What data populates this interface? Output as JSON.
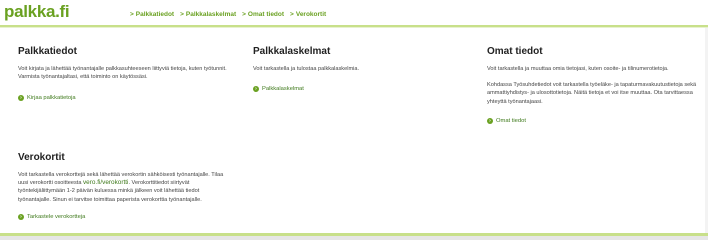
{
  "logo": {
    "text": "palkka.fi"
  },
  "nav": [
    {
      "label": "Palkkatiedot"
    },
    {
      "label": "Palkkalaskelmat"
    },
    {
      "label": "Omat tiedot"
    },
    {
      "label": "Verokortit"
    }
  ],
  "nav_arrow": ">",
  "colors": {
    "accent": "#6aa121",
    "link": "#3f7a1c",
    "stripe": "#c8e08a"
  },
  "cards": {
    "palkkatiedot": {
      "title": "Palkkatiedot",
      "text1": "Voit kirjata ja lähettää työnantajalle palkkasuhteeseen liittyviä tietoja, kuten työtunnit.",
      "text2": "Varmista työnantajaltasi, että toiminto on käytössäsi.",
      "link": "Kirjaa palkkatietoja"
    },
    "palkkalaskelmat": {
      "title": "Palkkalaskelmat",
      "text1": "Voit tarkastella ja tulostaa palkkalaskelmia.",
      "link": "Palkkalaskelmat"
    },
    "omat": {
      "title": "Omat tiedot",
      "text1": "Voit tarkastella ja muuttaa omia tietojasi, kuten osoite- ja tilinumerotietoja.",
      "text2": "Kohdassa Työsuhdetiedot voit tarkastella työeläke- ja tapaturmavakuutustietoja sekä ammattiyhdistys- ja ulosottotietoja. Näitä tietoja et voi itse muuttaa. Ota tarvittaessa yhteyttä työnantajaasi.",
      "link": "Omat tiedot"
    },
    "verokortit": {
      "title": "Verokortit",
      "text_a": "Voit tarkastella verokorttejä sekä lähettää verokortin sähköisesti työnantajalle. Tilaa uusi verokortti osoitteesta ",
      "inline_link": "vero.fi/verokortti",
      "text_b": ". Verokorttitiedot siirtyvät työntekijäliittymään 1-2 päivän kuluessa minkä jälkeen voit lähettää tiedot työnantajalle. Sinun ei tarvitse toimittaa paperista verokorttia työnantajalle.",
      "link": "Tarkastele verokortteja"
    }
  }
}
